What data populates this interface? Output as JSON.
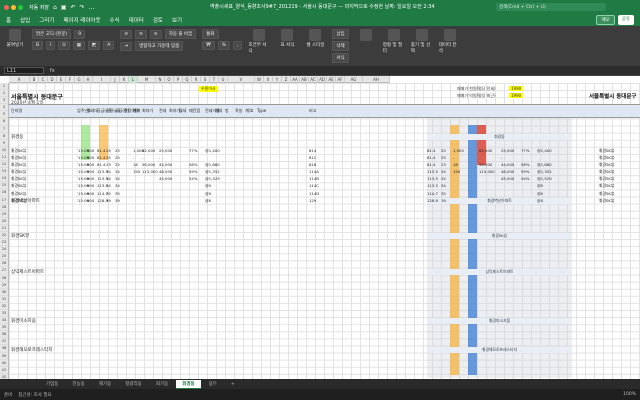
{
  "titlebar": {
    "autosave": "자동 저장",
    "doc_title": "역출시세표_양식_동향조사9#7_201219 - 서울시 동대문구 — 마지막으로 수정한 날짜: 일요일 오전 2:34",
    "search_placeholder": "검색(Cmd + Ctrl + U)"
  },
  "ribbon_tabs": [
    "홈",
    "삽입",
    "그리기",
    "페이지 레이아웃",
    "수식",
    "데이터",
    "검토",
    "보기"
  ],
  "memo_label": "메모",
  "share_label": "공유",
  "ribbon": {
    "paste": "붙여넣기",
    "font": "맑은 고딕 (본문)",
    "font_size": "9",
    "wrap": "자동 줄 바꿈",
    "merge": "병합하고 가운데 맞춤",
    "format": "통화",
    "cond_format": "조건부 서식",
    "table_format": "표 서식",
    "cell_style": "셀 스타일",
    "insert": "삽입",
    "delete": "삭제",
    "format_btn": "서식",
    "sort": "정렬 및 필터",
    "find": "찾기 및 선택",
    "analyze": "데이터 분석"
  },
  "formulabar": {
    "namebox": "L11",
    "fx": "fx"
  },
  "columns": [
    "A",
    "B",
    "C",
    "D",
    "E",
    "F",
    "G",
    "H",
    "I",
    "J",
    "K",
    "L",
    "M",
    "N",
    "O",
    "P",
    "Q",
    "R",
    "S",
    "T",
    "U",
    "V",
    "W",
    "X",
    "Y",
    "Z",
    "AA",
    "AB",
    "AC",
    "AD",
    "AE",
    "AF",
    "AG",
    "AH"
  ],
  "selected_column": "L",
  "sheet": {
    "title": "서울특별시 동대문구",
    "subtitle": "2020년 4월 1일",
    "title_right": "서울특별시 동대문구",
    "note_yellow": "우종이사",
    "note_r1": "매매가 천원/평당 전세)",
    "note_r1_val": "1990",
    "note_r2": "매매가 억원/평당 최근)",
    "note_r2_val": "1990",
    "headers": [
      "단지명",
      "입주년도",
      "총세대",
      "공급(㎡)",
      "전용(㎡)",
      "공급(평)",
      "전용(평)",
      "매매",
      "최저가",
      "전세",
      "최저가",
      "월세",
      "매전갭",
      "전세가율",
      "세대",
      "방",
      "욕실",
      "계/호",
      "Type",
      "비고"
    ],
    "sections": [
      {
        "label": "휘경동",
        "row": 8
      },
      {
        "label": "휘경벽산아파트",
        "row": 17
      },
      {
        "label": "휘경SK뷰",
        "row": 22
      },
      {
        "label": "삼익제스트아파트",
        "row": 27
      },
      {
        "label": "휘경미소지움",
        "row": 34
      },
      {
        "label": "휘경해모로프레스티지",
        "row": 38
      }
    ],
    "rows": [
      {
        "n": "휘경SK뷰",
        "y": "'15.06",
        "u": "900",
        "a": "81.4",
        "b": "25",
        "p": "25",
        "m": "1,000",
        "jm": "62,000",
        "j": "25,000",
        "r": "77%",
        "g": "@1,400",
        "t": "814"
      },
      {
        "n": "휘경SK뷰",
        "y": "'15.06",
        "u": "900",
        "a": "81.4",
        "b": "25",
        "p": "25",
        "m": "-",
        "jm": "-",
        "j": "-",
        "r": "",
        "g": "",
        "t": "81C"
      },
      {
        "n": "휘경SK뷰",
        "y": "'15.06",
        "u": "900",
        "a": "81.4",
        "b": "23",
        "p": "25",
        "m": "18",
        "jm": "56,000",
        "j": "44,000",
        "r": "58%",
        "g": "@1,880",
        "t": "816"
      },
      {
        "n": "휘경SK뷰",
        "y": "'15.06",
        "u": "900",
        "a": "113.5",
        "b": "34",
        "p": "34",
        "m": "150",
        "jm": "115,000",
        "j": "48,000",
        "r": "59%",
        "g": "@1,352",
        "t": "114A"
      },
      {
        "n": "휘경SK뷰",
        "y": "'15.06",
        "u": "900",
        "a": "113.5",
        "b": "34",
        "p": "34",
        "m": "",
        "jm": "",
        "j": "45,000",
        "r": "54%",
        "g": "@1,529",
        "t": "114B"
      },
      {
        "n": "휘경SK뷰",
        "y": "'15.06",
        "u": "900",
        "a": "113.5",
        "b": "34",
        "p": "34",
        "m": "",
        "jm": "",
        "j": "",
        "r": "",
        "g": "@0",
        "t": "114C"
      },
      {
        "n": "휘경SK뷰",
        "y": "'15.06",
        "u": "900",
        "a": "114.7",
        "b": "35",
        "p": "35",
        "m": "",
        "jm": "",
        "j": "",
        "r": "",
        "g": "@0",
        "t": "114D"
      },
      {
        "n": "휘경SK뷰",
        "y": "'15.06",
        "u": "900",
        "a": "128.9",
        "b": "39",
        "p": "39",
        "m": "",
        "jm": "",
        "j": "",
        "r": "",
        "g": "@0",
        "t": "129"
      }
    ]
  },
  "sheet_tabs": [
    "기업동",
    "전농동",
    "제기동",
    "청량리동",
    "회기동",
    "휘경동",
    "용두"
  ],
  "active_tab": "휘경동",
  "status": {
    "ready": "준비",
    "access": "접근성: 조사 필요",
    "zoom": "100%"
  }
}
